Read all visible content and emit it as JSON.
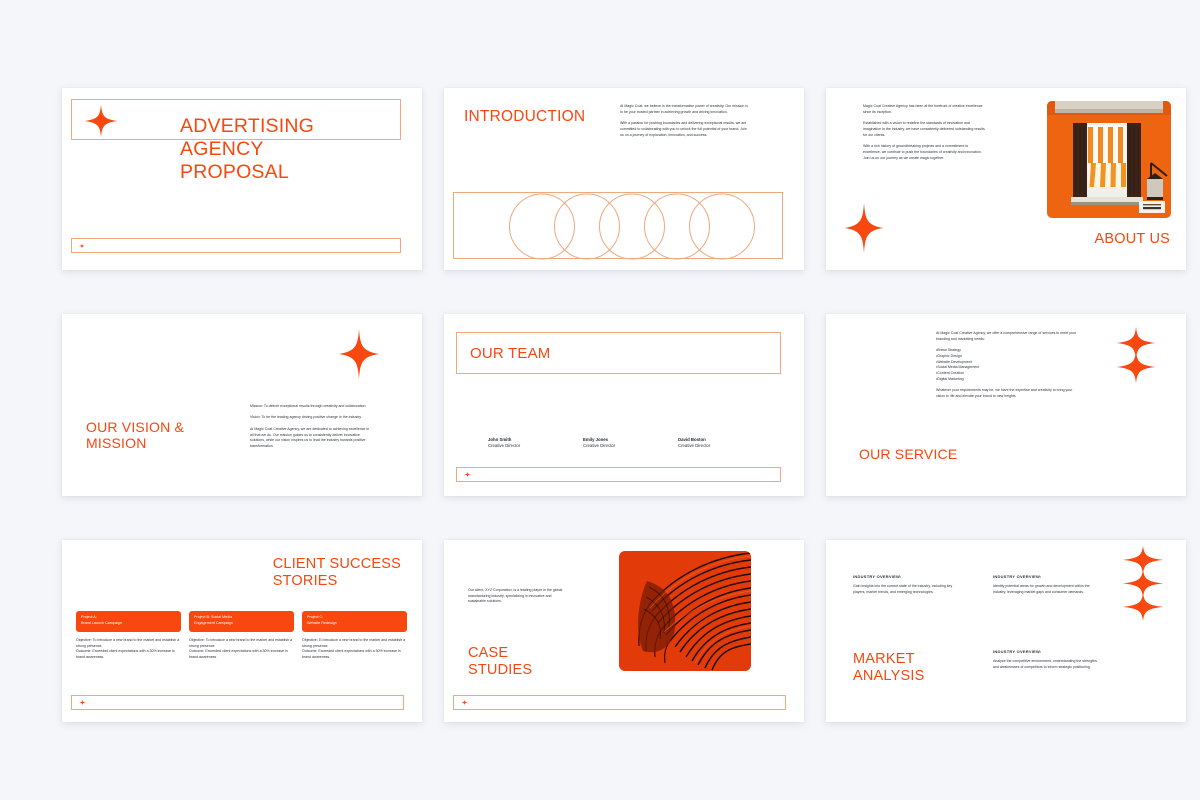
{
  "theme": {
    "accent": "#f8470f",
    "accent_soft": "#efa97f",
    "page_background": "#f4f6f9",
    "slide_background": "#ffffff",
    "text": "#2e3138"
  },
  "slides": [
    {
      "id": "cover",
      "title": "ADVERTISING\nAGENCY\nPROPOSAL",
      "icons": [
        "four-point-star",
        "plus-mark"
      ]
    },
    {
      "id": "introduction",
      "title": "INTRODUCTION",
      "body": "At Magic Coat, we believe in the transformative power of creativity. Our mission is to be your trusted partner in achieving growth and driving innovation.\n\nWith a passion for pushing boundaries and delivering exceptional results, we are committed to collaborating with you to unlock the full potential of your brand. Join us on a journey of exploration, innovation, and success.",
      "decoration": "five-overlapping-circles"
    },
    {
      "id": "about-us",
      "title": "ABOUT US",
      "body": "Magic Coat Creative Agency has been at the forefront of creative excellence since its inception.\n\nEstablished with a vision to redefine the standards of innovation and imagination in the industry, we have consistently delivered outstanding results for our clients.\n\nWith a rich history of groundbreaking projects and a commitment to excellence, we continue to push the boundaries of creativity and innovation. Join us on our journey as we create magic together.",
      "photo_caption": "orange-building-window-awning-lantern"
    },
    {
      "id": "vision-mission",
      "title": "OUR VISION &\nMISSION",
      "body": "Mission: To deliver exceptional results through creativity and collaboration.\n\nVision: To be the leading agency driving positive change in the industry.\n\nAt Magic Coat Creative Agency, we are dedicated to achieving excellence in all that we do. Our mission guides us to consistently deliver innovative solutions, while our vision inspires us to lead the industry towards positive transformation."
    },
    {
      "id": "our-team",
      "title": "OUR TEAM",
      "members": [
        {
          "name": "John Smith",
          "role": "Creative Director"
        },
        {
          "name": "Emily Jones",
          "role": "Creative Director"
        },
        {
          "name": "David Boston",
          "role": "Creative Director"
        }
      ]
    },
    {
      "id": "our-service",
      "title": "OUR SERVICE",
      "body": "At Magic Coat Creative Agency, we offer a comprehensive range of services to meet your branding and marketing needs:\n\n•Brand Strategy\n•Graphic Design\n•Website Development\n•Social Media Management\n•Content Creation\n•Digital Marketing\n\nWhatever your requirements may be, we have the expertise and creativity to bring your vision to life and elevate your brand to new heights"
    },
    {
      "id": "client-success-stories",
      "title": "CLIENT SUCCESS\nSTORIES",
      "cards": [
        {
          "heading": "Project A:\nBrand Launch Campaign",
          "body": "Objective: To introduce a new brand to the market and establish a strong presence.\nOutcome: Exceeded client expectations with a 30% increase in brand awareness."
        },
        {
          "heading": "Project B: Social Media\nEngagement Campaign",
          "body": "Objective: To introduce a new brand to the market and establish a strong presence.\nOutcome: Exceeded client expectations with a 30% increase in brand awareness."
        },
        {
          "heading": "Project C:\nWebsite Redesign",
          "body": "Objective: To introduce a new brand to the market and establish a strong presence.\nOutcome: Exceeded client expectations with a 30% increase in brand awareness."
        }
      ]
    },
    {
      "id": "case-studies",
      "title": "CASE\nSTUDIES",
      "body": "Our client, XYZ Corporation, is a leading player in the global manufacturing industry, specializing in innovative and sustainable solutions.",
      "photo_caption": "abstract-orange-radiating-structure"
    },
    {
      "id": "market-analysis",
      "title": "MARKET\nANALYSIS",
      "overview_label": "INDUSTRY OVERVIEW:",
      "overviews": [
        "Gain insights into the current state of the industry, including key players, market trends, and emerging technologies.",
        "Identify potential areas for growth and development within the industry, leveraging market gaps and consumer demands.",
        "Analyze the competitive environment, understanding the strengths and weaknesses of competitors to inform strategic positioning."
      ]
    }
  ]
}
